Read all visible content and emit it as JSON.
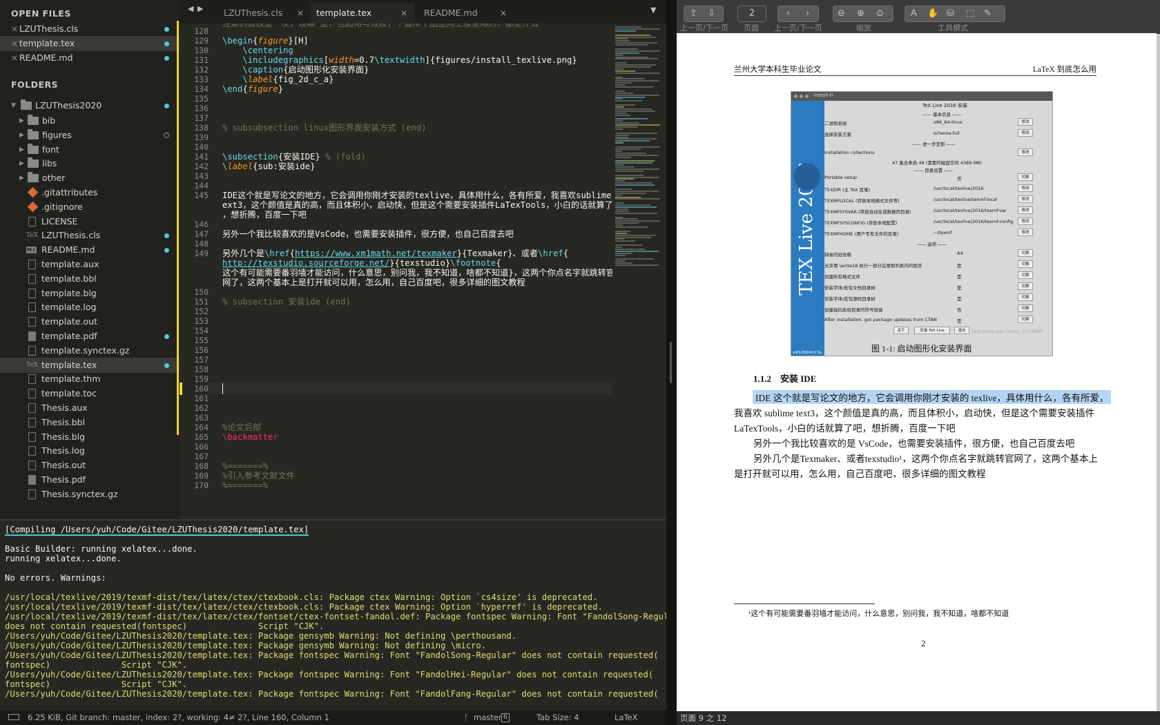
{
  "sidebar": {
    "open_files_title": "OPEN FILES",
    "open_files": [
      {
        "name": "LZUThesis.cls",
        "dot": true,
        "selected": false
      },
      {
        "name": "template.tex",
        "dot": true,
        "selected": true
      },
      {
        "name": "README.md",
        "dot": true,
        "selected": false
      }
    ],
    "folders_title": "FOLDERS",
    "root": "LZUThesis2020",
    "items": [
      {
        "name": "bib",
        "type": "folder"
      },
      {
        "name": "figures",
        "type": "folder",
        "odot": true
      },
      {
        "name": "font",
        "type": "folder"
      },
      {
        "name": "libs",
        "type": "folder"
      },
      {
        "name": "other",
        "type": "folder"
      },
      {
        "name": ".gitattributes",
        "type": "git"
      },
      {
        "name": ".gitignore",
        "type": "git"
      },
      {
        "name": "LICENSE",
        "type": "file"
      },
      {
        "name": "LZUThesis.cls",
        "type": "tex",
        "dot": true
      },
      {
        "name": "README.md",
        "type": "md",
        "dot": true
      },
      {
        "name": "template.aux",
        "type": "file"
      },
      {
        "name": "template.bbl",
        "type": "file"
      },
      {
        "name": "template.blg",
        "type": "file"
      },
      {
        "name": "template.log",
        "type": "file"
      },
      {
        "name": "template.out",
        "type": "file"
      },
      {
        "name": "template.pdf",
        "type": "pdf",
        "dot": true
      },
      {
        "name": "template.synctex.gz",
        "type": "file"
      },
      {
        "name": "template.tex",
        "type": "tex",
        "dot": true,
        "selected": true
      },
      {
        "name": "template.thm",
        "type": "file"
      },
      {
        "name": "template.toc",
        "type": "file"
      },
      {
        "name": "Thesis.aux",
        "type": "file"
      },
      {
        "name": "Thesis.bbl",
        "type": "file"
      },
      {
        "name": "Thesis.blg",
        "type": "file"
      },
      {
        "name": "Thesis.log",
        "type": "file"
      },
      {
        "name": "Thesis.out",
        "type": "file"
      },
      {
        "name": "Thesis.pdf",
        "type": "pdf"
      },
      {
        "name": "Thesis.synctex.gz",
        "type": "file"
      }
    ]
  },
  "tabs": {
    "nav_back": "◀",
    "nav_fwd": "▶",
    "items": [
      {
        "label": "LZUThesis.cls",
        "active": false
      },
      {
        "label": "template.tex",
        "active": true
      },
      {
        "label": "README.md",
        "active": false
      }
    ],
    "close": "×",
    "menu": "▼"
  },
  "editor": {
    "top_partial": "注意的波纹是一次，双嘛 是，也超用与双按，个面从个图是网上搜使用的，都是什么",
    "lines": [
      {
        "n": "128",
        "html": ""
      },
      {
        "n": "129",
        "html": "<span class='kw'>\\begin</span>{<span class='or'>figure</span>}[H]"
      },
      {
        "n": "130",
        "html": "    <span class='kw'>\\centering</span>"
      },
      {
        "n": "131",
        "html": "    <span class='kw'>\\includegraphics</span>[<span class='or'>width</span>=0.7<span class='kw'>\\textwidth</span>]{figures/install_texlive.png}"
      },
      {
        "n": "132",
        "html": "    <span class='kw'>\\caption</span>{启动图形化安装界面}"
      },
      {
        "n": "133",
        "html": "    <span class='kw'>\\</span><span class='or'>label</span>{fig_2d_c_a}"
      },
      {
        "n": "134",
        "html": "<span class='kw'>\\end</span>{<span class='or'>figure</span>}"
      },
      {
        "n": "135",
        "html": ""
      },
      {
        "n": "136",
        "html": ""
      },
      {
        "n": "137",
        "html": ""
      },
      {
        "n": "138",
        "html": "<span class='cm'>% subsubsection linux图形界面安装方式 (end)</span>"
      },
      {
        "n": "139",
        "html": ""
      },
      {
        "n": "140",
        "html": ""
      },
      {
        "n": "141",
        "html": "<span class='kw'>\\subsection</span>{安装IDE} <span class='cm'>% (fold)</span>"
      },
      {
        "n": "142",
        "html": "<span class='kw'>\\</span><span class='or'>label</span>{sub:安装ide}"
      },
      {
        "n": "143",
        "html": ""
      },
      {
        "n": "144",
        "html": ""
      },
      {
        "n": "145",
        "html": "IDE这个就是写论文的地方，它会调用你刚才安装的texlive，具体用什么，各有所爱，我喜欢sublime t\next3，这个颜值是真的高，而且体积小，启动快，但是这个需要安装插件LaTexTools，小白的话就算了吧\n，想折腾，百度一下吧"
      },
      {
        "n": "146",
        "html": ""
      },
      {
        "n": "147",
        "html": "另外一个我比较喜欢的是VsCode，也需要安装插件，很方便，也自己百度去吧"
      },
      {
        "n": "148",
        "html": ""
      },
      {
        "n": "149",
        "html": "另外几个是<span class='kw'>\\href</span>{<span class='url'>https://www.xm1math.net/texmaker</span>}{Texmaker}、或者<span class='kw'>\\href</span>{\n<span class='url'>http://texstudio.sourceforge.net/</span>}{texstudio}<span class='kw'>\\footnote</span>{\n这个有可能需要番羽墙才能访问，什么意思，别问我，我不知道，啥都不知道}，这两个你点名字就跳转官\n网了，这两个基本上是打开就可以用，怎么用，自己百度吧，很多详细的图文教程"
      },
      {
        "n": "150",
        "html": ""
      },
      {
        "n": "151",
        "html": "<span class='cm'>% subsection 安装ide (end)</span>"
      },
      {
        "n": "152",
        "html": ""
      },
      {
        "n": "153",
        "html": ""
      },
      {
        "n": "154",
        "html": ""
      },
      {
        "n": "155",
        "html": ""
      },
      {
        "n": "156",
        "html": ""
      },
      {
        "n": "157",
        "html": ""
      },
      {
        "n": "158",
        "html": ""
      },
      {
        "n": "159",
        "html": ""
      },
      {
        "n": "160",
        "html": ""
      },
      {
        "n": "161",
        "html": ""
      },
      {
        "n": "162",
        "html": ""
      },
      {
        "n": "163",
        "html": ""
      },
      {
        "n": "164",
        "html": "<span class='cm'>%论文后部</span>"
      },
      {
        "n": "165",
        "html": "<span class='pk'>\\backmatter</span>"
      },
      {
        "n": "166",
        "html": ""
      },
      {
        "n": "167",
        "html": ""
      },
      {
        "n": "168",
        "html": "<span class='cm'>%=======%</span>"
      },
      {
        "n": "169",
        "html": "<span class='cm'>%引入参考文献文件</span>"
      },
      {
        "n": "170",
        "html": "<span class='cm'>%=======%</span>"
      }
    ]
  },
  "console": {
    "compiling": "[Compiling /Users/yuh/Code/Gitee/LZUThesis2020/template.tex]",
    "lines": [
      {
        "t": "",
        "w": false
      },
      {
        "t": "Basic Builder: running xelatex...done.",
        "w": false
      },
      {
        "t": "running xelatex...done.",
        "w": false
      },
      {
        "t": "",
        "w": false
      },
      {
        "t": "No errors. Warnings:",
        "w": false
      },
      {
        "t": "",
        "w": false
      },
      {
        "t": "/usr/local/texlive/2019/texmf-dist/tex/latex/ctex/ctexbook.cls: Package ctex Warning: Option `cs4size' is deprecated.",
        "w": true
      },
      {
        "t": "/usr/local/texlive/2019/texmf-dist/tex/latex/ctex/ctexbook.cls: Package ctex Warning: Option `hyperref' is deprecated.",
        "w": true
      },
      {
        "t": "/usr/local/texlive/2019/texmf-dist/tex/latex/ctex/fontset/ctex-fontset-fandol.def: Package fontspec Warning: Font \"FandolSong-Regular\"",
        "w": true
      },
      {
        "t": "does not contain requested(fontspec)              Script \"CJK\".",
        "w": true
      },
      {
        "t": "/Users/yuh/Code/Gitee/LZUThesis2020/template.tex: Package gensymb Warning: Not defining \\perthousand.",
        "w": true
      },
      {
        "t": "/Users/yuh/Code/Gitee/LZUThesis2020/template.tex: Package gensymb Warning: Not defining \\micro.",
        "w": true
      },
      {
        "t": "/Users/yuh/Code/Gitee/LZUThesis2020/template.tex: Package fontspec Warning: Font \"FandolSong-Regular\" does not contain requested(",
        "w": true
      },
      {
        "t": "fontspec)              Script \"CJK\".",
        "w": true
      },
      {
        "t": "/Users/yuh/Code/Gitee/LZUThesis2020/template.tex: Package fontspec Warning: Font \"FandolHei-Regular\" does not contain requested(",
        "w": true
      },
      {
        "t": "fontspec)              Script \"CJK\".",
        "w": true
      },
      {
        "t": "/Users/yuh/Code/Gitee/LZUThesis2020/template.tex: Package fontspec Warning: Font \"FandolFang-Regular\" does not contain requested(",
        "w": true
      }
    ]
  },
  "status": {
    "left": "6.25 KiB, Git branch: master, index: 2?, working: 4≠ 2?, Line 160, Column 1",
    "branch": "master",
    "branch_count": "6",
    "tab_size": "Tab Size: 4",
    "syntax": "LaTeX"
  },
  "viewer": {
    "toolbar": {
      "page_value": "2",
      "labels": {
        "pageupdown": "上一页/下一页",
        "page": "页面",
        "backfwd": "上一页/下一页",
        "zoom": "缩放",
        "tools": "工具模式"
      }
    },
    "pdf": {
      "header_left": "兰州大学本科生毕业论文",
      "header_right": "LaTeX 到底怎么用",
      "figure": {
        "window_title": "install-tl",
        "header": "TeX Live 2016 安装",
        "basic": "—— 基本信息 ——",
        "further": "—— 进一步定制 ——",
        "dirs": "—— 目录设置 ——",
        "options": "—— 选项 ——",
        "sidebar_text": "TEX Live 2016",
        "version": "v#1293/4117&",
        "watermark": "http://blog.csdn.net/qq_29129689",
        "rows": [
          {
            "l": "二进制系统",
            "v": "x86_64-linux",
            "b": "修改"
          },
          {
            "l": "选择安装方案",
            "v": "scheme-full",
            "b": "修改"
          },
          {
            "l": "Installation collections",
            "v": "",
            "b": "修改"
          },
          {
            "l": "47 集合来自 48 (需要的磁盘空间 4389 MB)",
            "v": "",
            "b": ""
          },
          {
            "l": "Portable setup",
            "v": "否",
            "b": "切换"
          },
          {
            "l": "TEXDIR (主 TeX 目录)",
            "v": "/usr/local/texlive/2016",
            "b": "修改"
          },
          {
            "l": "TEXMFLOCAL (存放本地格式文件等)",
            "v": "/usr/local/texlive/texmf-local",
            "b": "修改"
          },
          {
            "l": "TEXMFSYSVAR (存放自动生成数据的目录)",
            "v": "/usr/local/texlive/2016/texmf-var",
            "b": "修改"
          },
          {
            "l": "TEXMFSYSCONFIG (存放本地配置)",
            "v": "/usr/local/texlive/2016/texmf-config",
            "b": "修改"
          },
          {
            "l": "TEXMFHOME (用户专有文件的目录)",
            "v": "~/texmf",
            "b": "修改"
          },
          {
            "l": "缺省的纸张格",
            "v": "A4",
            "b": "切换"
          },
          {
            "l": "允许用 \\write18 执行一部分在限制列表内的程序",
            "v": "是",
            "b": "切换"
          },
          {
            "l": "创建所有格式文件",
            "v": "是",
            "b": "切换"
          },
          {
            "l": "安装字体/宏包文档目录树",
            "v": "是",
            "b": "切换"
          },
          {
            "l": "安装字体/宏包源码目录树",
            "v": "是",
            "b": "切换"
          },
          {
            "l": "创建指向系统目录的符号链接",
            "v": "否",
            "b": "切换"
          },
          {
            "l": "After installation, get package updates from CTAN",
            "v": "是",
            "b": "切换"
          }
        ],
        "buttons": [
          "关于",
          "安装 TeX Live",
          "退出"
        ]
      },
      "caption": "图 1-1: 启动图形化安装界面",
      "section": "1.1.2    安装 IDE",
      "para1_hl": "IDE 这个就是写论文的地方，它会调用你刚才安装的 texlive，具体用什么，各有所爱，",
      "para1_b": "我喜欢 sublime text3，这个颜值是真的高，而且体积小，启动快，但是这个需要安装插件",
      "para1_c": "LaTexTools，小白的话就算了吧，想折腾，百度一下吧",
      "para2": "另外一个我比较喜欢的是 VsCode，也需要安装插件，很方便，也自己百度去吧",
      "para3_a": "另外几个是Texmaker、或者texstudio¹，这两个你点名字就跳转官网了，这两个基本上",
      "para3_b": "是打开就可以用，怎么用，自己百度吧，很多详细的图文教程",
      "footnote": "¹这个有可能需要番羽墙才能访问，什么意思，别问我，我不知道，啥都不知道",
      "page_number": "2"
    },
    "status": "页面 9 之 12"
  }
}
